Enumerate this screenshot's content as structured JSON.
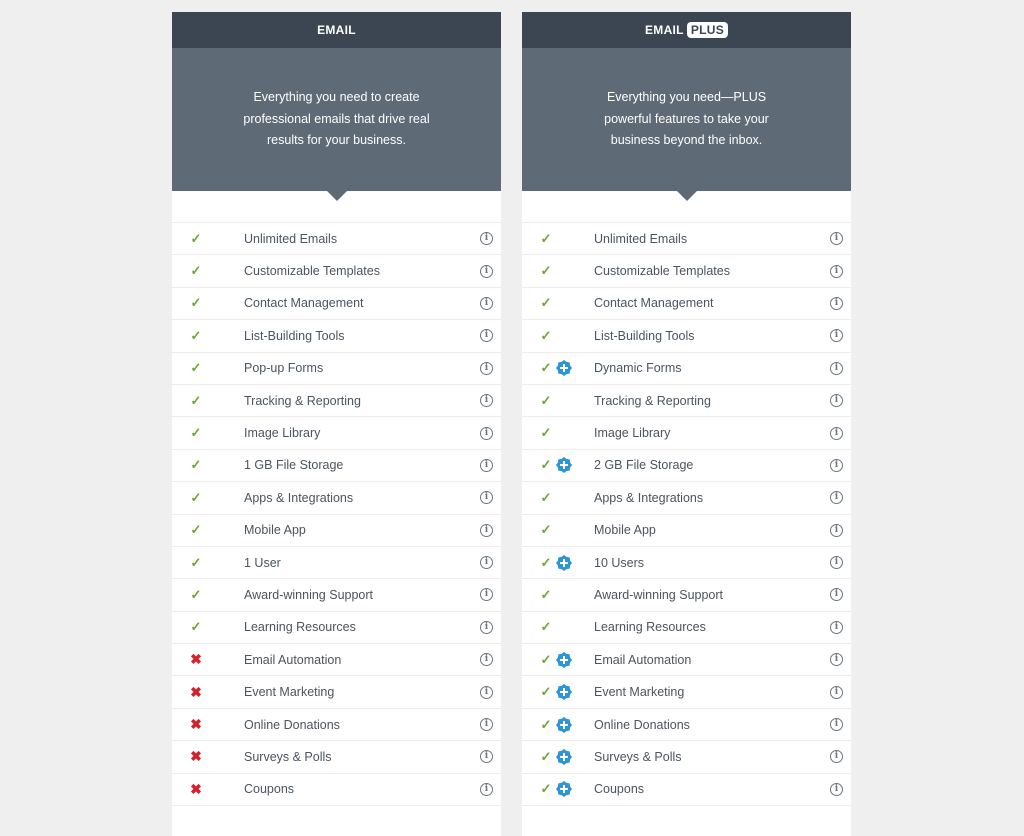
{
  "plans": [
    {
      "name": "EMAIL",
      "badge": "",
      "description": "Everything you need to create professional emails that drive real results for your business.",
      "features": [
        {
          "label": "Unlimited Emails",
          "included": true,
          "plus": false
        },
        {
          "label": "Customizable Templates",
          "included": true,
          "plus": false
        },
        {
          "label": "Contact Management",
          "included": true,
          "plus": false
        },
        {
          "label": "List-Building Tools",
          "included": true,
          "plus": false
        },
        {
          "label": "Pop-up Forms",
          "included": true,
          "plus": false
        },
        {
          "label": "Tracking & Reporting",
          "included": true,
          "plus": false
        },
        {
          "label": "Image Library",
          "included": true,
          "plus": false
        },
        {
          "label": "1 GB File Storage",
          "included": true,
          "plus": false
        },
        {
          "label": "Apps & Integrations",
          "included": true,
          "plus": false
        },
        {
          "label": "Mobile App",
          "included": true,
          "plus": false
        },
        {
          "label": "1 User",
          "included": true,
          "plus": false
        },
        {
          "label": "Award-winning Support",
          "included": true,
          "plus": false
        },
        {
          "label": "Learning Resources",
          "included": true,
          "plus": false
        },
        {
          "label": "Email Automation",
          "included": false,
          "plus": false
        },
        {
          "label": "Event Marketing",
          "included": false,
          "plus": false
        },
        {
          "label": "Online Donations",
          "included": false,
          "plus": false
        },
        {
          "label": "Surveys & Polls",
          "included": false,
          "plus": false
        },
        {
          "label": "Coupons",
          "included": false,
          "plus": false
        }
      ]
    },
    {
      "name": "EMAIL",
      "badge": "PLUS",
      "description": "Everything you need—PLUS powerful features to take your business beyond the inbox.",
      "features": [
        {
          "label": "Unlimited Emails",
          "included": true,
          "plus": false
        },
        {
          "label": "Customizable Templates",
          "included": true,
          "plus": false
        },
        {
          "label": "Contact Management",
          "included": true,
          "plus": false
        },
        {
          "label": "List-Building Tools",
          "included": true,
          "plus": false
        },
        {
          "label": "Dynamic Forms",
          "included": true,
          "plus": true
        },
        {
          "label": "Tracking & Reporting",
          "included": true,
          "plus": false
        },
        {
          "label": "Image Library",
          "included": true,
          "plus": false
        },
        {
          "label": "2 GB File Storage",
          "included": true,
          "plus": true
        },
        {
          "label": "Apps & Integrations",
          "included": true,
          "plus": false
        },
        {
          "label": "Mobile App",
          "included": true,
          "plus": false
        },
        {
          "label": "10 Users",
          "included": true,
          "plus": true
        },
        {
          "label": "Award-winning Support",
          "included": true,
          "plus": false
        },
        {
          "label": "Learning Resources",
          "included": true,
          "plus": false
        },
        {
          "label": "Email Automation",
          "included": true,
          "plus": true
        },
        {
          "label": "Event Marketing",
          "included": true,
          "plus": true
        },
        {
          "label": "Online Donations",
          "included": true,
          "plus": true
        },
        {
          "label": "Surveys & Polls",
          "included": true,
          "plus": true
        },
        {
          "label": "Coupons",
          "included": true,
          "plus": true
        }
      ]
    }
  ],
  "icons": {
    "check": "✓",
    "cross": "✖",
    "info": "i"
  },
  "colors": {
    "header": "#3b4652",
    "description": "#5e6a76",
    "check": "#6aa631",
    "cross": "#d9202a",
    "plus_icon": "#2d95d3"
  }
}
